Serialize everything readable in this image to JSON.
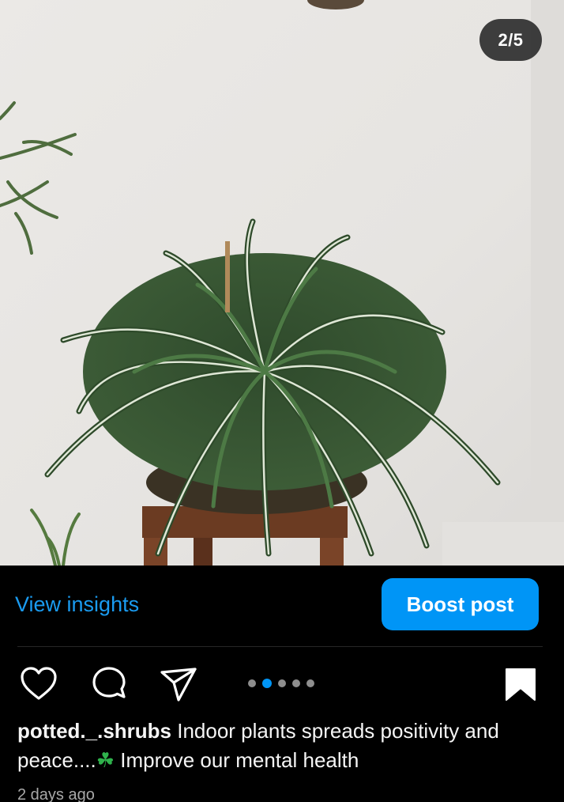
{
  "media": {
    "counter": "2/5",
    "current_slide": 2,
    "total_slides": 5
  },
  "promo": {
    "insights_label": "View insights",
    "boost_label": "Boost post",
    "accent_color": "#0095f6"
  },
  "actions": {
    "icons": [
      "heart-icon",
      "comment-icon",
      "share-icon",
      "bookmark-icon"
    ]
  },
  "caption": {
    "username": "potted._.shrubs",
    "text_part1": " Indoor plants spreads positivity and peace....",
    "emoji": "☘",
    "text_part2": " Improve our mental health"
  },
  "timestamp": "2 days ago"
}
